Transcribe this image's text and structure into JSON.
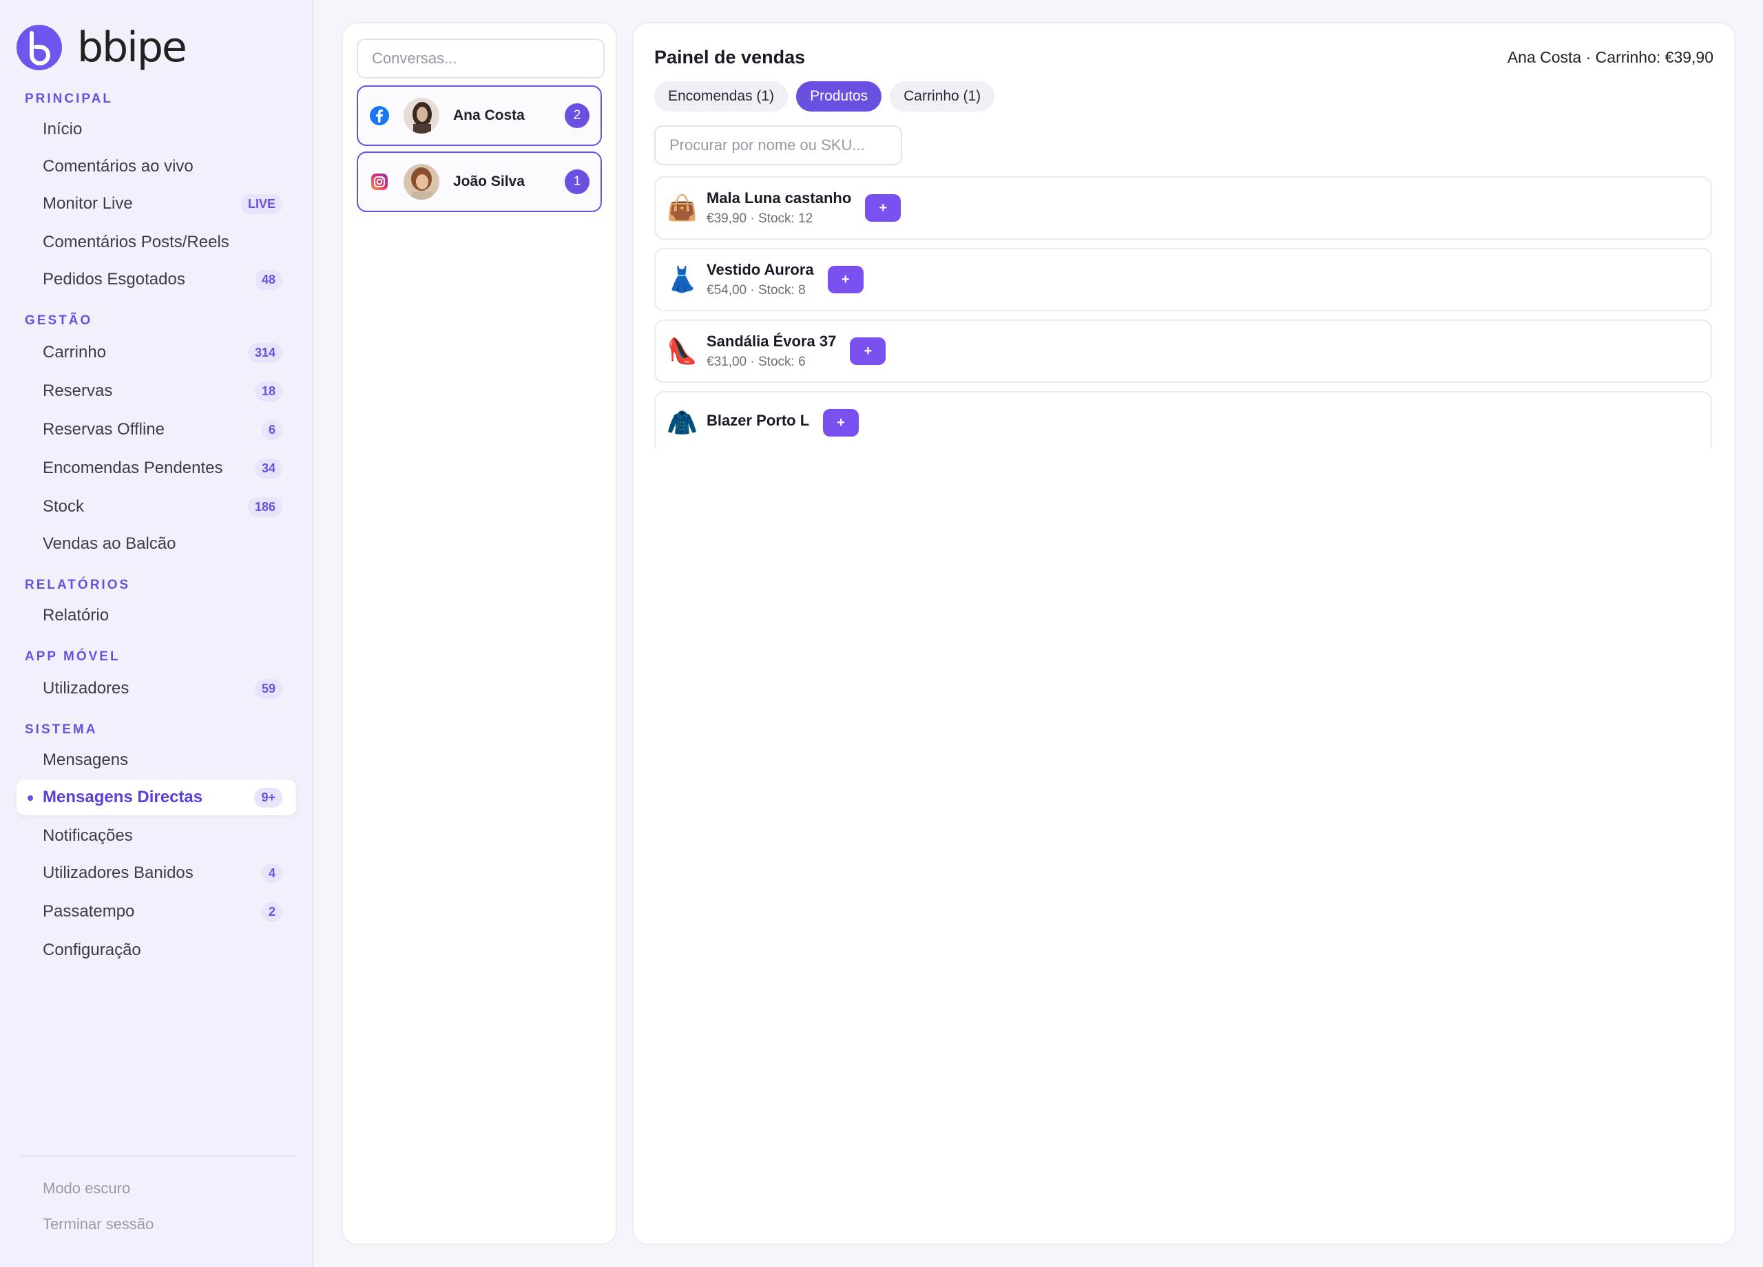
{
  "brand": {
    "name": "bbipe",
    "logo_icon": "b-logo-icon"
  },
  "sidebar": {
    "sections": [
      {
        "title": "Principal"
      },
      {
        "title": "Gestão"
      },
      {
        "title": "Relatórios"
      },
      {
        "title": "App Móvel"
      },
      {
        "title": "Sistema"
      }
    ],
    "items": [
      {
        "label": "Início",
        "badge": ""
      },
      {
        "label": "Comentários ao vivo",
        "badge": ""
      },
      {
        "label": "Monitor Live",
        "badge": "LIVE"
      },
      {
        "label": "Comentários Posts/Reels",
        "badge": ""
      },
      {
        "label": "Pedidos Esgotados",
        "badge": "48"
      },
      {
        "label": "Carrinho",
        "badge": "314"
      },
      {
        "label": "Reservas",
        "badge": "18"
      },
      {
        "label": "Reservas Offline",
        "badge": "6"
      },
      {
        "label": "Encomendas Pendentes",
        "badge": "34"
      },
      {
        "label": "Stock",
        "badge": "186"
      },
      {
        "label": "Vendas ao Balcão",
        "badge": ""
      },
      {
        "label": "Relatório",
        "badge": ""
      },
      {
        "label": "Utilizadores",
        "badge": "59"
      },
      {
        "label": "Mensagens",
        "badge": ""
      },
      {
        "label": "Mensagens Directas",
        "badge": "9+"
      },
      {
        "label": "Notificações",
        "badge": ""
      },
      {
        "label": "Utilizadores Banidos",
        "badge": "4"
      },
      {
        "label": "Passatempo",
        "badge": "2"
      },
      {
        "label": "Configuração",
        "badge": ""
      }
    ],
    "active_item": "Mensagens Directas",
    "footer": {
      "dark_mode": "Modo escuro",
      "logout": "Terminar sessão"
    }
  },
  "conversations": {
    "search_placeholder": "Conversas...",
    "items": [
      {
        "name": "Ana Costa",
        "count": "2",
        "platform": "facebook-icon"
      },
      {
        "name": "João Silva",
        "count": "1",
        "platform": "instagram-icon"
      }
    ]
  },
  "sales": {
    "title": "Painel de vendas",
    "status": "Ana Costa · Carrinho: €39,90",
    "tabs": [
      {
        "label": "Encomendas (1)",
        "active": false
      },
      {
        "label": "Produtos",
        "active": true
      },
      {
        "label": "Carrinho (1)",
        "active": false
      }
    ],
    "search_placeholder": "Procurar por nome ou SKU...",
    "add_label": "+",
    "products": [
      {
        "emoji": "👜",
        "name": "Mala Luna castanho",
        "meta": "€39,90 · Stock: 12"
      },
      {
        "emoji": "👗",
        "name": "Vestido Aurora",
        "meta": "€54,00 · Stock: 8"
      },
      {
        "emoji": "👠",
        "name": "Sandália Évora 37",
        "meta": "€31,00 · Stock: 6"
      },
      {
        "emoji": "🧥",
        "name": "Blazer Porto L",
        "meta": ""
      }
    ]
  },
  "colors": {
    "accent": "#6b4fe0",
    "button": "#7a4ff0",
    "sidebar_bg": "#f2f1fb",
    "facebook": "#1877f2",
    "instagram": "#e1306c"
  }
}
